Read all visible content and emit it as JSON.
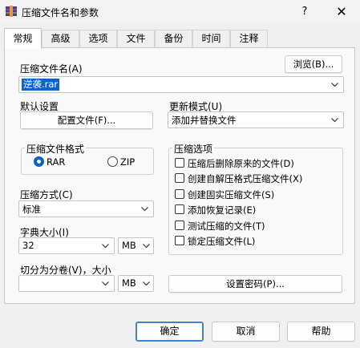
{
  "window": {
    "title": "压缩文件名和参数",
    "help_glyph": "?",
    "close_glyph": "✕"
  },
  "tabs": [
    {
      "label": "常规",
      "active": true
    },
    {
      "label": "高级"
    },
    {
      "label": "选项"
    },
    {
      "label": "文件"
    },
    {
      "label": "备份"
    },
    {
      "label": "时间"
    },
    {
      "label": "注释"
    }
  ],
  "archive_name": {
    "label": "压缩文件名(A)",
    "browse_label": "浏览(B)...",
    "value": "逆袭.rar"
  },
  "default_settings": {
    "label": "默认设置",
    "profiles_button": "配置文件(F)..."
  },
  "update_mode": {
    "label": "更新模式(U)",
    "value": "添加并替换文件"
  },
  "archive_format": {
    "label": "压缩文件格式",
    "options": [
      "RAR",
      "ZIP"
    ],
    "selected": "RAR"
  },
  "compression_method": {
    "label": "压缩方式(C)",
    "value": "标准"
  },
  "dictionary_size": {
    "label": "字典大小(I)",
    "value": "32",
    "unit": "MB"
  },
  "split_volumes": {
    "label": "切分为分卷(V)，大小",
    "value": "",
    "unit": "MB"
  },
  "archiving_options": {
    "label": "压缩选项",
    "items": [
      {
        "label": "压缩后删除原来的文件(D)",
        "checked": false
      },
      {
        "label": "创建自解压格式压缩文件(X)",
        "checked": false
      },
      {
        "label": "创建固实压缩文件(S)",
        "checked": false
      },
      {
        "label": "添加恢复记录(E)",
        "checked": false
      },
      {
        "label": "测试压缩的文件(T)",
        "checked": false
      },
      {
        "label": "锁定压缩文件(L)",
        "checked": false
      }
    ]
  },
  "set_password_button": "设置密码(P)...",
  "footer": {
    "ok": "确定",
    "cancel": "取消",
    "help": "帮助"
  },
  "colors": {
    "accent": "#0a5fc4",
    "selection": "#0a64c9",
    "window_bg": "#f0f0f0"
  }
}
